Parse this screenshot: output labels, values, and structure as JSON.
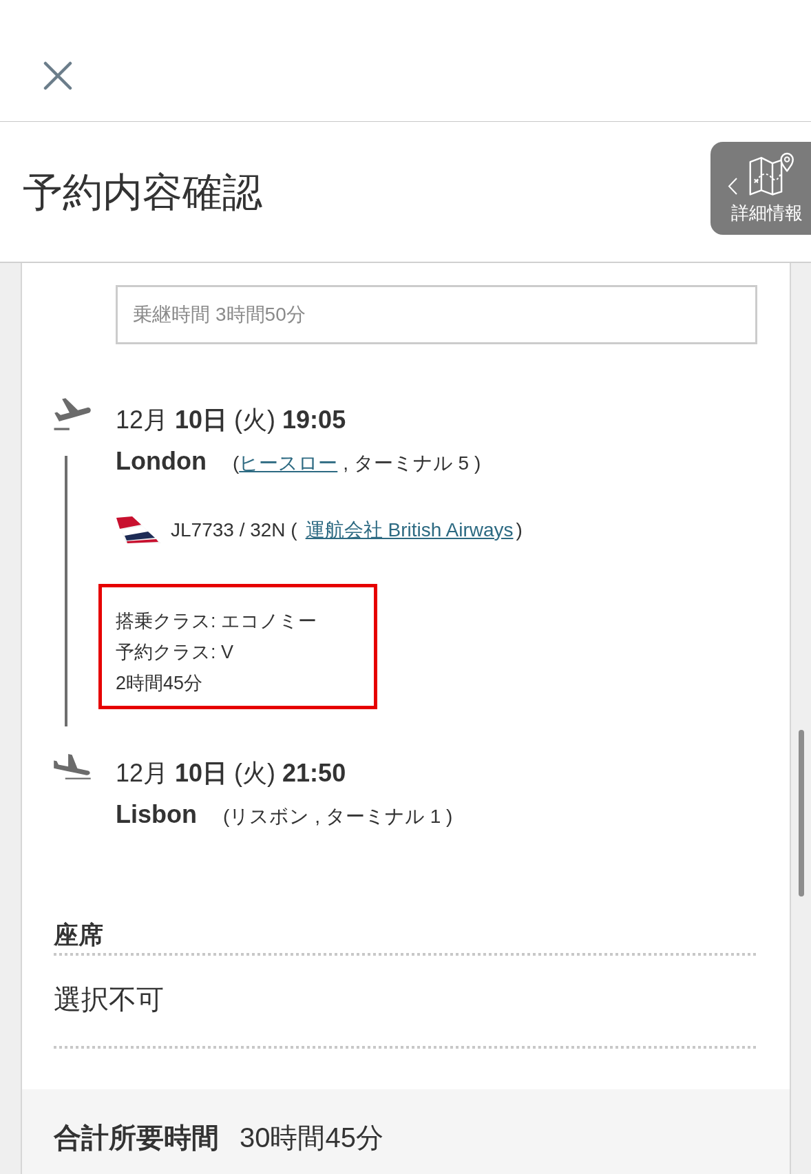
{
  "header": {
    "title": "予約内容確認"
  },
  "details_tab": {
    "label": "詳細情報"
  },
  "connection": {
    "label": "乗継時間",
    "duration": "3時間50分"
  },
  "segment": {
    "departure": {
      "kind": "departure",
      "datetime": "12月 **10日** (火) **19:05**",
      "city": "London",
      "place": {
        "open": "(",
        "airport": "ヒースロー",
        "airport_link": true,
        "rest": ", ターミナル 5 )"
      }
    },
    "flight": {
      "text": "JL7733 / 32N (",
      "operator": "運航会社 British Airways",
      "close": ")"
    },
    "class_info": {
      "highlighted": true,
      "lines": [
        "搭乗クラス: エコノミー",
        "予約クラス: V",
        "2時間45分"
      ]
    },
    "arrival": {
      "kind": "arrival",
      "datetime": "12月 **10日** (火) **21:50**",
      "city": "Lisbon",
      "place": {
        "open": "(",
        "airport": "リスボン",
        "airport_link": false,
        "rest": ", ターミナル 1 )"
      }
    }
  },
  "seat": {
    "heading": "座席",
    "value": "選択不可"
  },
  "total": {
    "label": "合計所要時間",
    "value": "30時間45分"
  }
}
